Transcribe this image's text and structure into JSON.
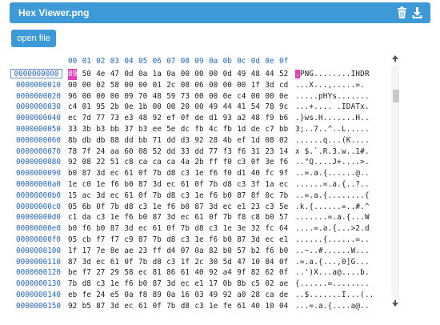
{
  "window": {
    "title": "Hex Viewer.png"
  },
  "toolbar": {
    "open_label": "open file"
  },
  "columns": [
    "00",
    "01",
    "02",
    "03",
    "04",
    "05",
    "06",
    "07",
    "08",
    "09",
    "0a",
    "0b",
    "0c",
    "0d",
    "0e",
    "0f"
  ],
  "rows": [
    {
      "addr": "0000000000",
      "hex": [
        "89",
        "50",
        "4e",
        "47",
        "0d",
        "0a",
        "1a",
        "0a",
        "00",
        "00",
        "00",
        "0d",
        "49",
        "48",
        "44",
        "52"
      ],
      "ascii": ".PNG........IHDR"
    },
    {
      "addr": "0000000010",
      "hex": [
        "00",
        "00",
        "02",
        "58",
        "00",
        "00",
        "01",
        "2c",
        "08",
        "06",
        "00",
        "00",
        "00",
        "1f",
        "3d",
        "cd"
      ],
      "ascii": "...X...,.....=."
    },
    {
      "addr": "0000000020",
      "hex": [
        "96",
        "00",
        "00",
        "00",
        "09",
        "70",
        "48",
        "59",
        "73",
        "00",
        "00",
        "0e",
        "c4",
        "00",
        "00",
        "0e"
      ],
      "ascii": ".....pHYs......."
    },
    {
      "addr": "0000000030",
      "hex": [
        "c4",
        "01",
        "95",
        "2b",
        "0e",
        "1b",
        "00",
        "00",
        "20",
        "00",
        "49",
        "44",
        "41",
        "54",
        "78",
        "9c"
      ],
      "ascii": "...+.... .IDATx."
    },
    {
      "addr": "0000000040",
      "hex": [
        "ec",
        "7d",
        "77",
        "73",
        "e3",
        "48",
        "92",
        "ef",
        "0f",
        "de",
        "d1",
        "93",
        "a2",
        "48",
        "f9",
        "b6"
      ],
      "ascii": ".}ws.H.......H.."
    },
    {
      "addr": "0000000050",
      "hex": [
        "33",
        "3b",
        "b3",
        "bb",
        "37",
        "b3",
        "ee",
        "5e",
        "dc",
        "fb",
        "4c",
        "fb",
        "1d",
        "de",
        "c7",
        "bb"
      ],
      "ascii": "3;..7..^..L....."
    },
    {
      "addr": "0000000060",
      "hex": [
        "8b",
        "db",
        "db",
        "88",
        "dd",
        "bb",
        "71",
        "dd",
        "d3",
        "92",
        "28",
        "4b",
        "ef",
        "1d",
        "08",
        "02"
      ],
      "ascii": "......q...(K...."
    },
    {
      "addr": "0000000070",
      "hex": [
        "78",
        "7f",
        "24",
        "aa",
        "60",
        "08",
        "52",
        "dd",
        "33",
        "dd",
        "77",
        "f3",
        "f6",
        "31",
        "23",
        "14"
      ],
      "ascii": "x $.`.R.3.w..1#."
    },
    {
      "addr": "0000000080",
      "hex": [
        "92",
        "08",
        "22",
        "51",
        "c8",
        "ca",
        "ca",
        "ca",
        "4a",
        "2b",
        "ff",
        "f0",
        "c3",
        "0f",
        "3e",
        "f6"
      ],
      "ascii": "..\"Q....J+....>."
    },
    {
      "addr": "0000000090",
      "hex": [
        "b0",
        "87",
        "3d",
        "ec",
        "61",
        "0f",
        "7b",
        "d8",
        "c3",
        "1e",
        "f6",
        "f0",
        "d1",
        "40",
        "fc",
        "9f"
      ],
      "ascii": "..=.a.{......@.."
    },
    {
      "addr": "00000000a0",
      "hex": [
        "1e",
        "c0",
        "1e",
        "f6",
        "b0",
        "87",
        "3d",
        "ec",
        "61",
        "0f",
        "7b",
        "d8",
        "c3",
        "3f",
        "1a",
        "ec"
      ],
      "ascii": "......=.a.{..?.."
    },
    {
      "addr": "00000000b0",
      "hex": [
        "15",
        "ac",
        "3d",
        "ec",
        "61",
        "0f",
        "7b",
        "d8",
        "c3",
        "1e",
        "f6",
        "b0",
        "87",
        "8f",
        "0c",
        "7b"
      ],
      "ascii": "..=.a.{........{"
    },
    {
      "addr": "00000000c0",
      "hex": [
        "05",
        "6b",
        "0f",
        "7b",
        "d8",
        "c3",
        "1e",
        "f6",
        "b0",
        "87",
        "3d",
        "ec",
        "e1",
        "23",
        "c3",
        "5e"
      ],
      "ascii": ".k.{......=..#.^"
    },
    {
      "addr": "00000000d0",
      "hex": [
        "c1",
        "da",
        "c3",
        "1e",
        "f6",
        "b0",
        "87",
        "3d",
        "ec",
        "61",
        "0f",
        "7b",
        "f8",
        "c8",
        "b0",
        "57"
      ],
      "ascii": ".......=.a.{...W"
    },
    {
      "addr": "00000000e0",
      "hex": [
        "b0",
        "f6",
        "b0",
        "87",
        "3d",
        "ec",
        "61",
        "0f",
        "7b",
        "d8",
        "c3",
        "1e",
        "3e",
        "32",
        "fc",
        "64"
      ],
      "ascii": "....=.a.{...>2.d"
    },
    {
      "addr": "00000000f0",
      "hex": [
        "05",
        "cb",
        "f7",
        "f7",
        "c9",
        "87",
        "7b",
        "d8",
        "c3",
        "1e",
        "f6",
        "b0",
        "87",
        "3d",
        "ec",
        "e1"
      ],
      "ascii": "......{......=.."
    },
    {
      "addr": "0000000100",
      "hex": [
        "1f",
        "17",
        "7e",
        "8e",
        "ae",
        "23",
        "ff",
        "d4",
        "07",
        "0a",
        "82",
        "b0",
        "57",
        "b2",
        "f6",
        "b0"
      ],
      "ascii": "..~..#......W..."
    },
    {
      "addr": "0000000110",
      "hex": [
        "87",
        "3d",
        "ec",
        "61",
        "0f",
        "7b",
        "d8",
        "c3",
        "1f",
        "2c",
        "30",
        "5d",
        "47",
        "10",
        "84",
        "0f"
      ],
      "ascii": ".=.a.{...,0]G..."
    },
    {
      "addr": "0000000120",
      "hex": [
        "be",
        "f7",
        "27",
        "29",
        "58",
        "ec",
        "81",
        "86",
        "61",
        "40",
        "92",
        "a4",
        "9f",
        "82",
        "62",
        "0f"
      ],
      "ascii": "..')X...a@....b."
    },
    {
      "addr": "0000000130",
      "hex": [
        "7b",
        "d8",
        "c3",
        "1e",
        "f6",
        "b0",
        "87",
        "3d",
        "ec",
        "e1",
        "17",
        "0b",
        "8b",
        "c5",
        "02",
        "ae"
      ],
      "ascii": "{......=........"
    },
    {
      "addr": "0000000140",
      "hex": [
        "eb",
        "fe",
        "24",
        "e5",
        "0a",
        "f8",
        "89",
        "0a",
        "16",
        "03",
        "49",
        "92",
        "a0",
        "28",
        "ca",
        "de"
      ],
      "ascii": "..$.......I...(.."
    },
    {
      "addr": "0000000150",
      "hex": [
        "92",
        "b5",
        "87",
        "3d",
        "ec",
        "61",
        "0f",
        "7b",
        "d8",
        "c3",
        "1e",
        "fe",
        "61",
        "40",
        "10",
        "04"
      ],
      "ascii": "...=.a.{....a@.."
    }
  ],
  "selection": {
    "row": 0,
    "byte": 0
  },
  "colors": {
    "accent": "#3d9ad6",
    "address": "#2468c2",
    "highlight": "#e83fb8"
  },
  "icons": {
    "delete": "trash-icon",
    "download": "download-icon",
    "scroll_up": "arrow-up-icon",
    "scroll_down": "arrow-down-icon"
  }
}
